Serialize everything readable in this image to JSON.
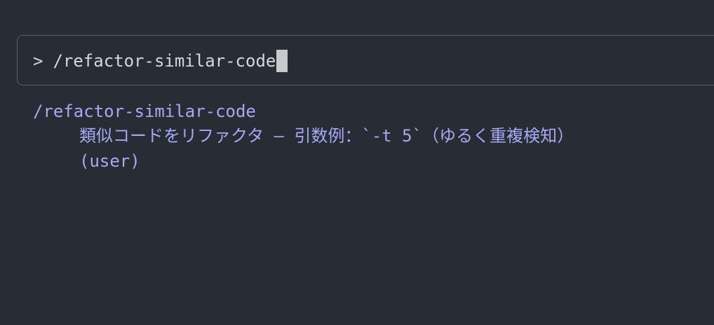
{
  "prompt": {
    "symbol": ">",
    "input_value": "/refactor-similar-code"
  },
  "suggestion": {
    "command": "/refactor-similar-code",
    "description": "類似コードをリファクタ – 引数例：`-t 5`（ゆるく重複検知）",
    "source": "(user)"
  },
  "colors": {
    "background": "#282c35",
    "input_text": "#d4d7dc",
    "suggestion_text": "#a7a9f2",
    "border": "#5a5f69",
    "cursor": "#c8c9cc"
  }
}
